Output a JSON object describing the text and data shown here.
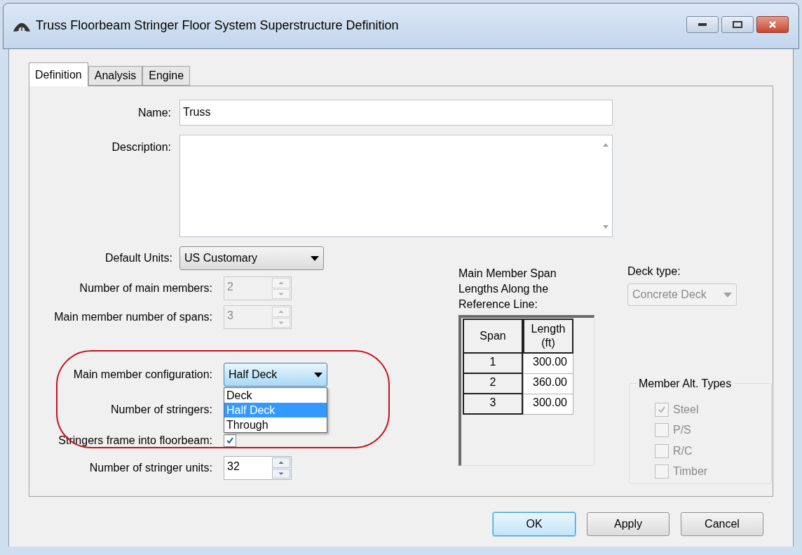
{
  "window": {
    "title": "Truss Floorbeam Stringer Floor System Superstructure Definition"
  },
  "tabs": [
    {
      "label": "Definition",
      "selected": true
    },
    {
      "label": "Analysis",
      "selected": false
    },
    {
      "label": "Engine",
      "selected": false
    }
  ],
  "name": {
    "label": "Name:",
    "value": "Truss"
  },
  "description": {
    "label": "Description:"
  },
  "default_units": {
    "label": "Default Units:",
    "value": "US Customary"
  },
  "main_members": {
    "label": "Number of main members:",
    "value": "2",
    "disabled": true
  },
  "spans": {
    "label": "Main member number of spans:",
    "value": "3",
    "disabled": true
  },
  "configuration": {
    "label": "Main member configuration:",
    "value": "Half Deck",
    "expanded": true,
    "options": [
      {
        "label": "Deck",
        "selected": false
      },
      {
        "label": "Half Deck",
        "selected": true
      },
      {
        "label": "Through",
        "selected": false
      }
    ]
  },
  "stringers": {
    "label": "Number of stringers:"
  },
  "frame_into_floorbeam": {
    "label": "Stringers frame into floorbeam:",
    "checked": true
  },
  "stringer_units": {
    "label": "Number of stringer units:",
    "value": "32",
    "disabled": false
  },
  "span_lengths": {
    "title": "Main Member Span Lengths Along the Reference Line:",
    "columns": [
      "Span",
      "Length (ft)"
    ],
    "rows": [
      [
        "1",
        "300.00"
      ],
      [
        "2",
        "360.00"
      ],
      [
        "3",
        "300.00"
      ]
    ]
  },
  "deck_type": {
    "label": "Deck type:",
    "value": "Concrete Deck",
    "disabled": true
  },
  "member_alt_types": {
    "title": "Member Alt. Types",
    "disabled": true,
    "items": [
      {
        "label": "Steel",
        "checked": true
      },
      {
        "label": "P/S",
        "checked": false
      },
      {
        "label": "R/C",
        "checked": false
      },
      {
        "label": "Timber",
        "checked": false
      }
    ]
  },
  "buttons": [
    {
      "label": "OK",
      "default": true
    },
    {
      "label": "Apply",
      "default": false
    },
    {
      "label": "Cancel",
      "default": false
    }
  ]
}
